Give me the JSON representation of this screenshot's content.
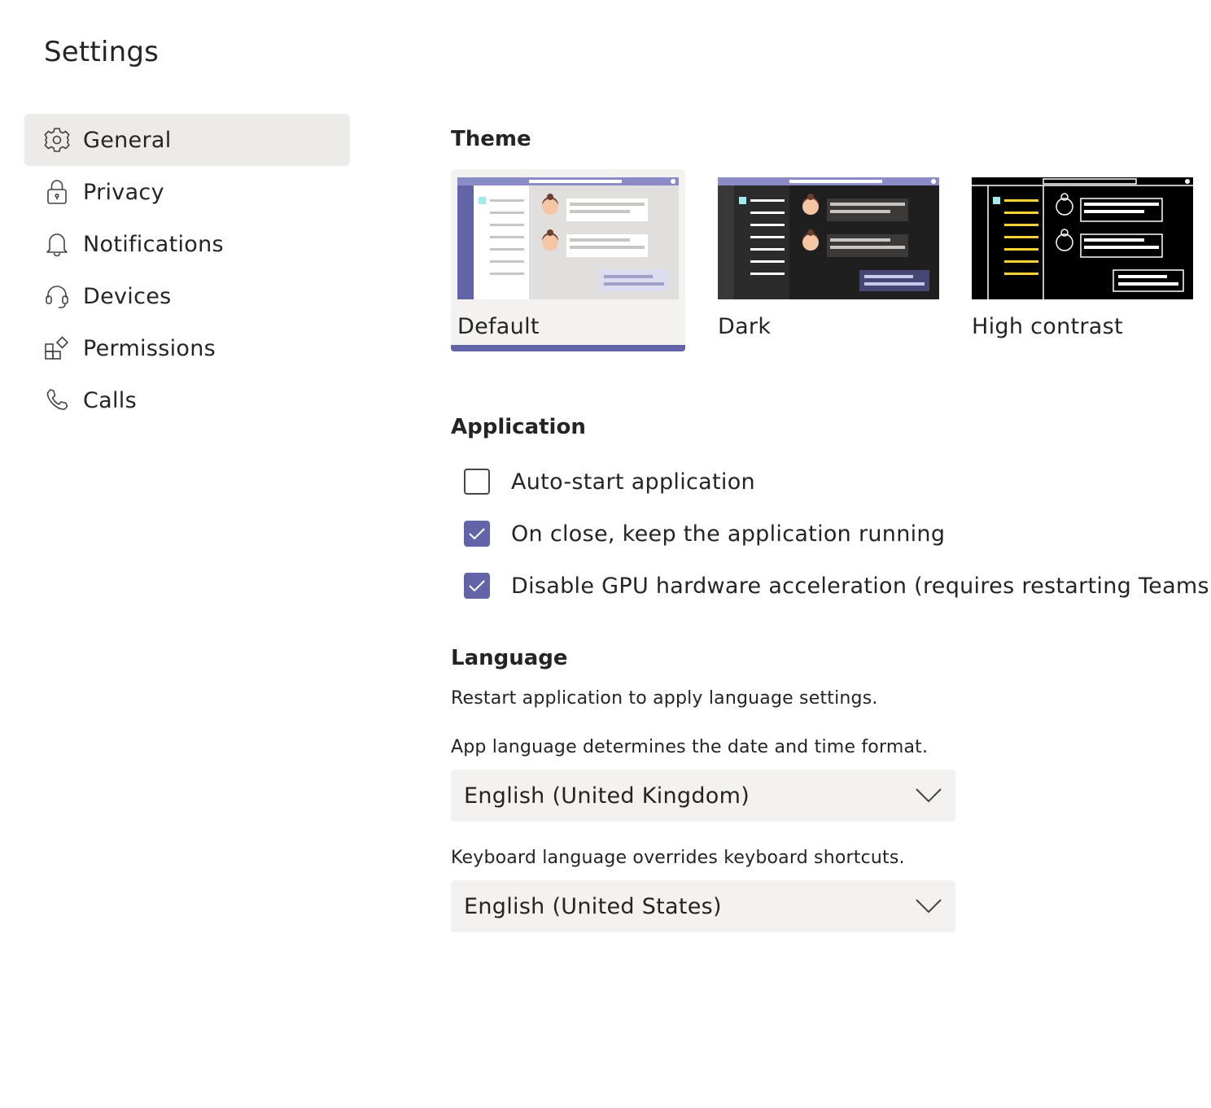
{
  "page": {
    "title": "Settings"
  },
  "sidebar": {
    "items": [
      {
        "label": "General",
        "icon": "gear-icon",
        "active": true
      },
      {
        "label": "Privacy",
        "icon": "lock-icon"
      },
      {
        "label": "Notifications",
        "icon": "bell-icon"
      },
      {
        "label": "Devices",
        "icon": "headset-icon"
      },
      {
        "label": "Permissions",
        "icon": "apps-icon"
      },
      {
        "label": "Calls",
        "icon": "phone-icon"
      }
    ]
  },
  "theme": {
    "title": "Theme",
    "selected": "Default",
    "options": [
      {
        "label": "Default"
      },
      {
        "label": "Dark"
      },
      {
        "label": "High contrast"
      }
    ]
  },
  "application": {
    "title": "Application",
    "options": [
      {
        "label": "Auto-start application",
        "checked": false
      },
      {
        "label": "On close, keep the application running",
        "checked": true
      },
      {
        "label": "Disable GPU hardware acceleration (requires restarting Teams)",
        "checked": true
      }
    ]
  },
  "language": {
    "title": "Language",
    "restart_note": "Restart application to apply language settings.",
    "app_language": {
      "description": "App language determines the date and time format.",
      "value": "English (United Kingdom)"
    },
    "keyboard_language": {
      "description": "Keyboard language overrides keyboard shortcuts.",
      "value": "English (United States)"
    }
  },
  "colors": {
    "accent": "#6264a7",
    "selected_nav_bg": "#edebe9",
    "dropdown_bg": "#f3f2f1",
    "high_contrast_yellow": "#ffd335"
  }
}
